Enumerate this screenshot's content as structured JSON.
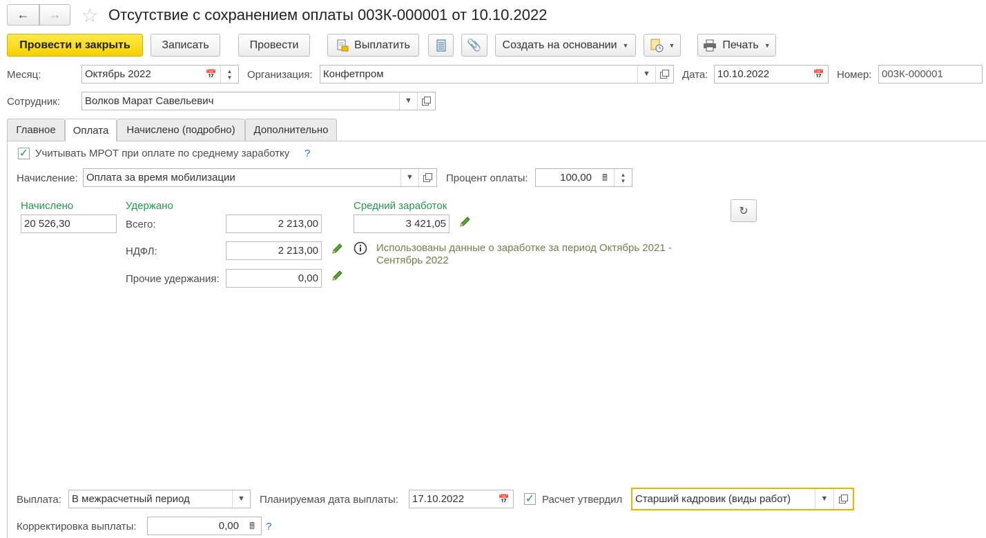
{
  "header": {
    "title": "Отсутствие с сохранением оплаты 003К-000001 от 10.10.2022"
  },
  "toolbar": {
    "post_close": "Провести и закрыть",
    "save": "Записать",
    "post": "Провести",
    "pay": "Выплатить",
    "create_based": "Создать на основании",
    "print": "Печать"
  },
  "fields": {
    "month_label": "Месяц:",
    "month_value": "Октябрь 2022",
    "org_label": "Организация:",
    "org_value": "Конфетпром",
    "date_label": "Дата:",
    "date_value": "10.10.2022",
    "number_label": "Номер:",
    "number_value": "003К-000001",
    "employee_label": "Сотрудник:",
    "employee_value": "Волков Марат Савельевич"
  },
  "tabs": [
    {
      "label": "Главное"
    },
    {
      "label": "Оплата"
    },
    {
      "label": "Начислено (подробно)"
    },
    {
      "label": "Дополнительно"
    }
  ],
  "payment": {
    "mrot_checkbox_label": "Учитывать МРОТ при оплате по среднему заработку",
    "mrot_checked": true,
    "help": "?",
    "accrual_label": "Начисление:",
    "accrual_value": "Оплата за время мобилизации",
    "percent_label": "Процент оплаты:",
    "percent_value": "100,00",
    "accrued_label": "Начислено",
    "accrued_value": "20 526,30",
    "withheld_label": "Удержано",
    "total_label": "Всего:",
    "total_value": "2 213,00",
    "ndfl_label": "НДФЛ:",
    "ndfl_value": "2 213,00",
    "other_label": "Прочие удержания:",
    "other_value": "0,00",
    "avg_label": "Средний заработок",
    "avg_value": "3 421,05",
    "info_text_line1": "Использованы данные о заработке за период Октябрь 2021 -",
    "info_text_line2": "Сентябрь 2022"
  },
  "bottom": {
    "payout_label": "Выплата:",
    "payout_value": "В межрасчетный период",
    "planned_date_label": "Планируемая дата выплаты:",
    "planned_date_value": "17.10.2022",
    "approved_label": "Расчет утвердил",
    "approved_checked": true,
    "approver_value": "Старший кадровик (виды работ)",
    "correction_label": "Корректировка выплаты:",
    "correction_value": "0,00",
    "help": "?"
  },
  "colors": {
    "accent_yellow": "#f5d100",
    "green_labels": "#1f9a4a",
    "focus_border": "#e8b400",
    "help_blue": "#2a6fc9"
  }
}
